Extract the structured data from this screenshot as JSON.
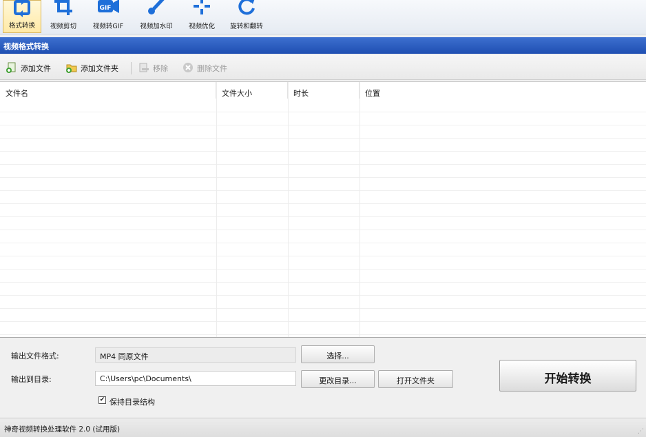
{
  "toolbar": {
    "items": [
      {
        "label": "格式转换",
        "icon": "convert-arrows-icon",
        "active": true
      },
      {
        "label": "视频剪切",
        "icon": "crop-icon",
        "active": false
      },
      {
        "label": "视频转GIF",
        "icon": "gif-camera-icon",
        "active": false
      },
      {
        "label": "视频加水印",
        "icon": "brush-icon",
        "active": false
      },
      {
        "label": "视频优化",
        "icon": "sparkle-icon",
        "active": false
      },
      {
        "label": "旋转和翻转",
        "icon": "rotate-icon",
        "active": false
      }
    ],
    "accent": "#1e6fd9"
  },
  "panel": {
    "title": "视频格式转换",
    "color": "#2a5bbf"
  },
  "actions": {
    "add_file": "添加文件",
    "add_folder": "添加文件夹",
    "remove": "移除",
    "delete_file": "删除文件"
  },
  "table": {
    "columns": [
      "文件名",
      "文件大小",
      "时长",
      "位置"
    ],
    "rows": []
  },
  "settings": {
    "output_format_label": "输出文件格式:",
    "output_format_value": "MP4 同原文件",
    "select_button": "选择...",
    "output_dir_label": "输出到目录:",
    "output_dir_value": "C:\\Users\\pc\\Documents\\",
    "change_dir_button": "更改目录...",
    "open_folder_button": "打开文件夹",
    "keep_structure_label": "保持目录结构",
    "keep_structure_checked": true,
    "start_button": "开始转换"
  },
  "status": {
    "text": "神奇视频转换处理软件 2.0 (试用版)"
  }
}
